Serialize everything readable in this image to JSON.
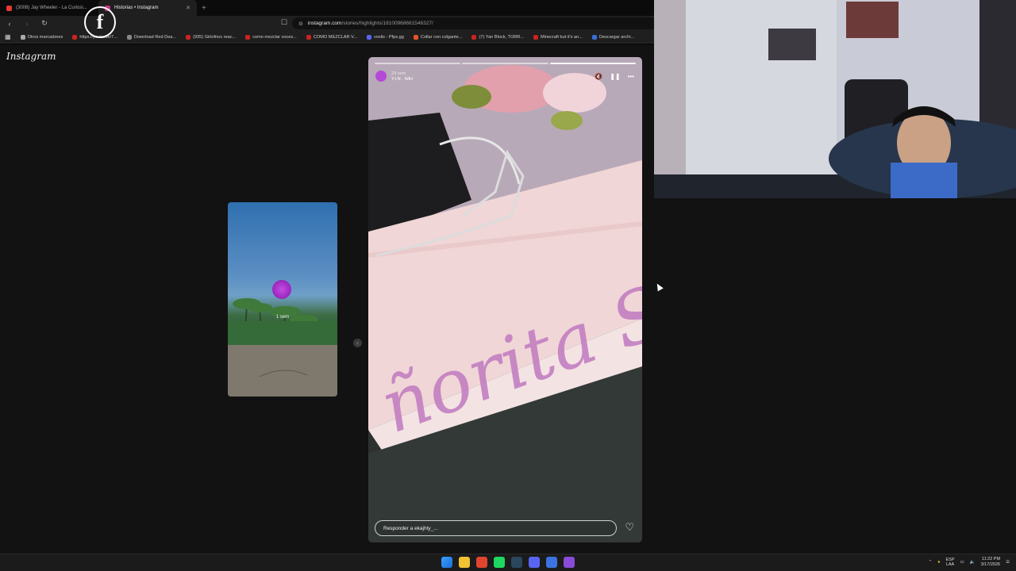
{
  "browser": {
    "tabs": [
      {
        "title": "(3008) Jay Wheeler - La Curiosi...",
        "active": false,
        "favicon_color": "#e53935"
      },
      {
        "title": "Historias • Instagram",
        "active": true,
        "favicon_color": "#c13584"
      }
    ],
    "new_tab_symbol": "+",
    "url_host": "instagram.com",
    "url_path": "/stories/highlights/18100968661546327/",
    "bookmarks": [
      "Otros marcadores",
      "https://youtu.be/7...",
      "Download Red Dea...",
      "(935) Girlofnox reac...",
      "como mezclar voces...",
      "COMO MEZCLAR V...",
      "voxlis - Pfps.gg",
      "Collar con colgante...",
      "(7) Yan Block, TORR...",
      "Minecraft but it's an...",
      "Descargar archi..."
    ]
  },
  "instagram": {
    "logo": "Instagram",
    "prev_story_time": "1 sem",
    "story": {
      "time": "29 sem",
      "music": "Y.I.N · IMH",
      "reply_placeholder": "Responder a ekajhty_..."
    }
  },
  "taskbar": {
    "lang_top": "ESP",
    "lang_bottom": "LAA",
    "time": "11:22 PM",
    "date": "3/17/2026"
  }
}
